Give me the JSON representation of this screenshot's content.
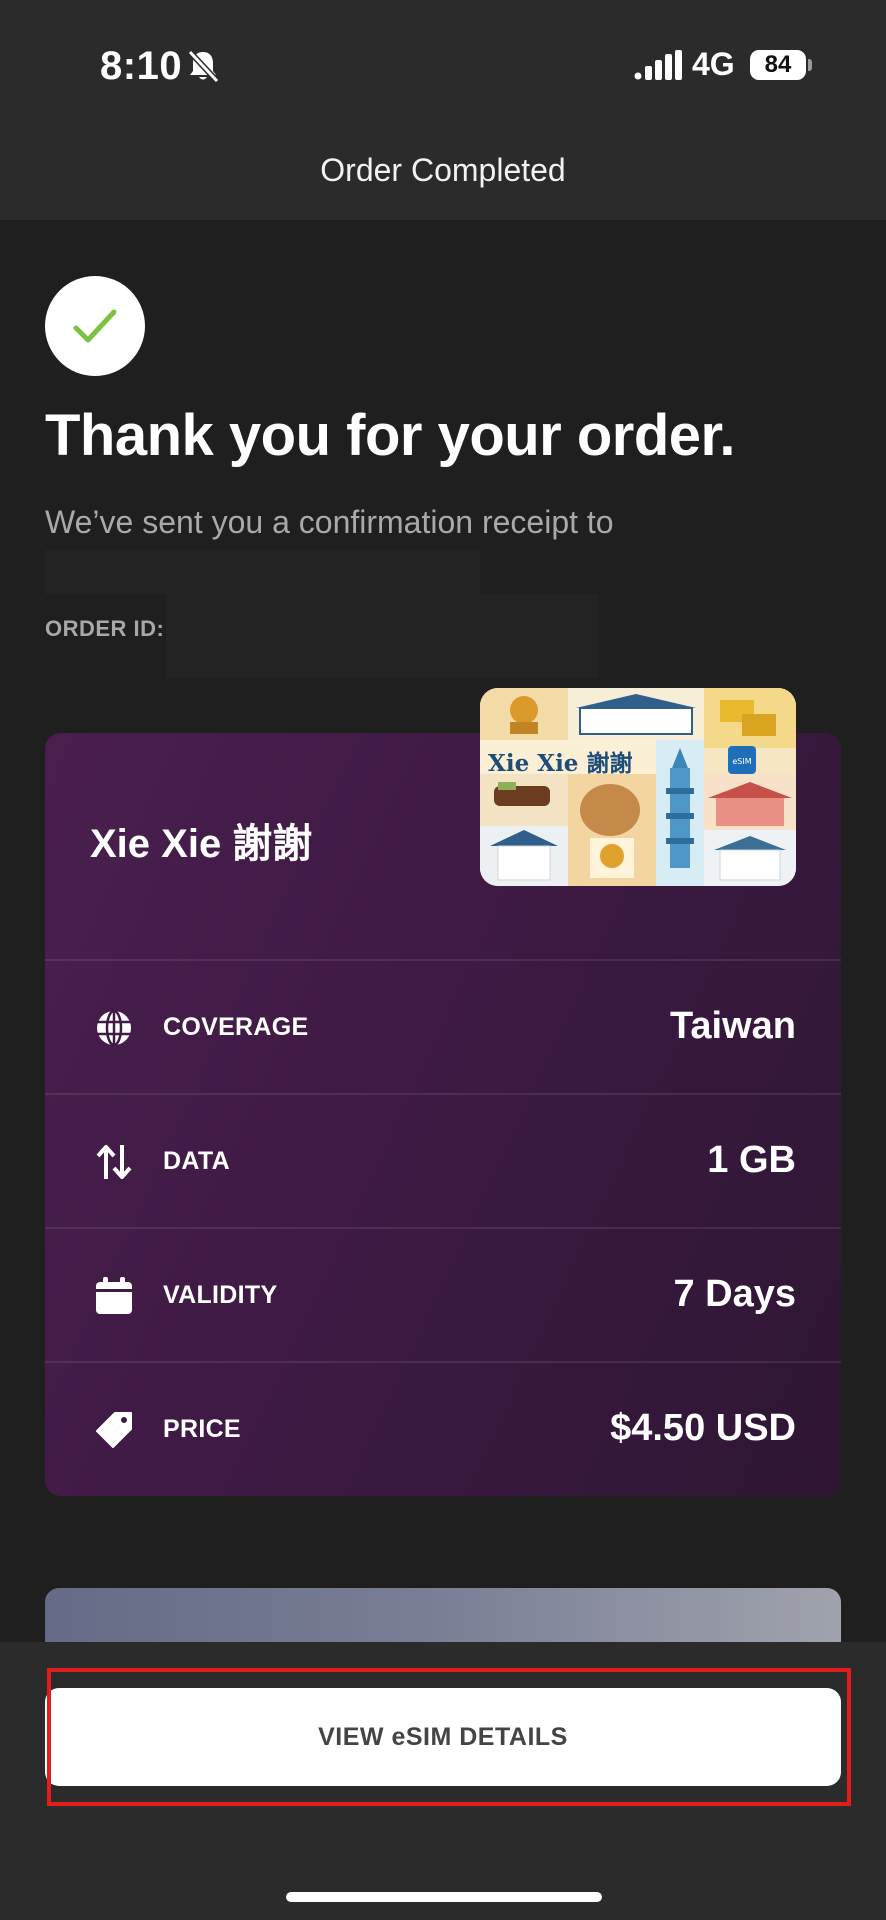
{
  "status_bar": {
    "time": "8:10",
    "network": "4G",
    "battery": "84",
    "icons": [
      "bell-muted-icon",
      "signal-icon"
    ]
  },
  "nav": {
    "title": "Order Completed"
  },
  "confirmation": {
    "icon": "check-icon",
    "heading": "Thank you for your order.",
    "receipt_text": "We’ve sent you a confirmation receipt to",
    "order_id_label": "ORDER ID:"
  },
  "plan_card": {
    "title": "Xie Xie 謝謝",
    "sim_brand": "Xie Xie 謝謝",
    "sim_badge": "eSIM",
    "rows": [
      {
        "icon": "globe-icon",
        "label": "COVERAGE",
        "value": "Taiwan"
      },
      {
        "icon": "arrows-up-down-icon",
        "label": "DATA",
        "value": "1 GB"
      },
      {
        "icon": "calendar-icon",
        "label": "VALIDITY",
        "value": "7 Days"
      },
      {
        "icon": "tag-icon",
        "label": "PRICE",
        "value": "$4.50 USD"
      }
    ]
  },
  "actions": {
    "view_esim_label": "VIEW eSIM DETAILS"
  },
  "colors": {
    "card_gradient_start": "#4a1f4e",
    "card_gradient_end": "#2e1633",
    "highlight": "#e01e1e",
    "check": "#7cc242"
  }
}
